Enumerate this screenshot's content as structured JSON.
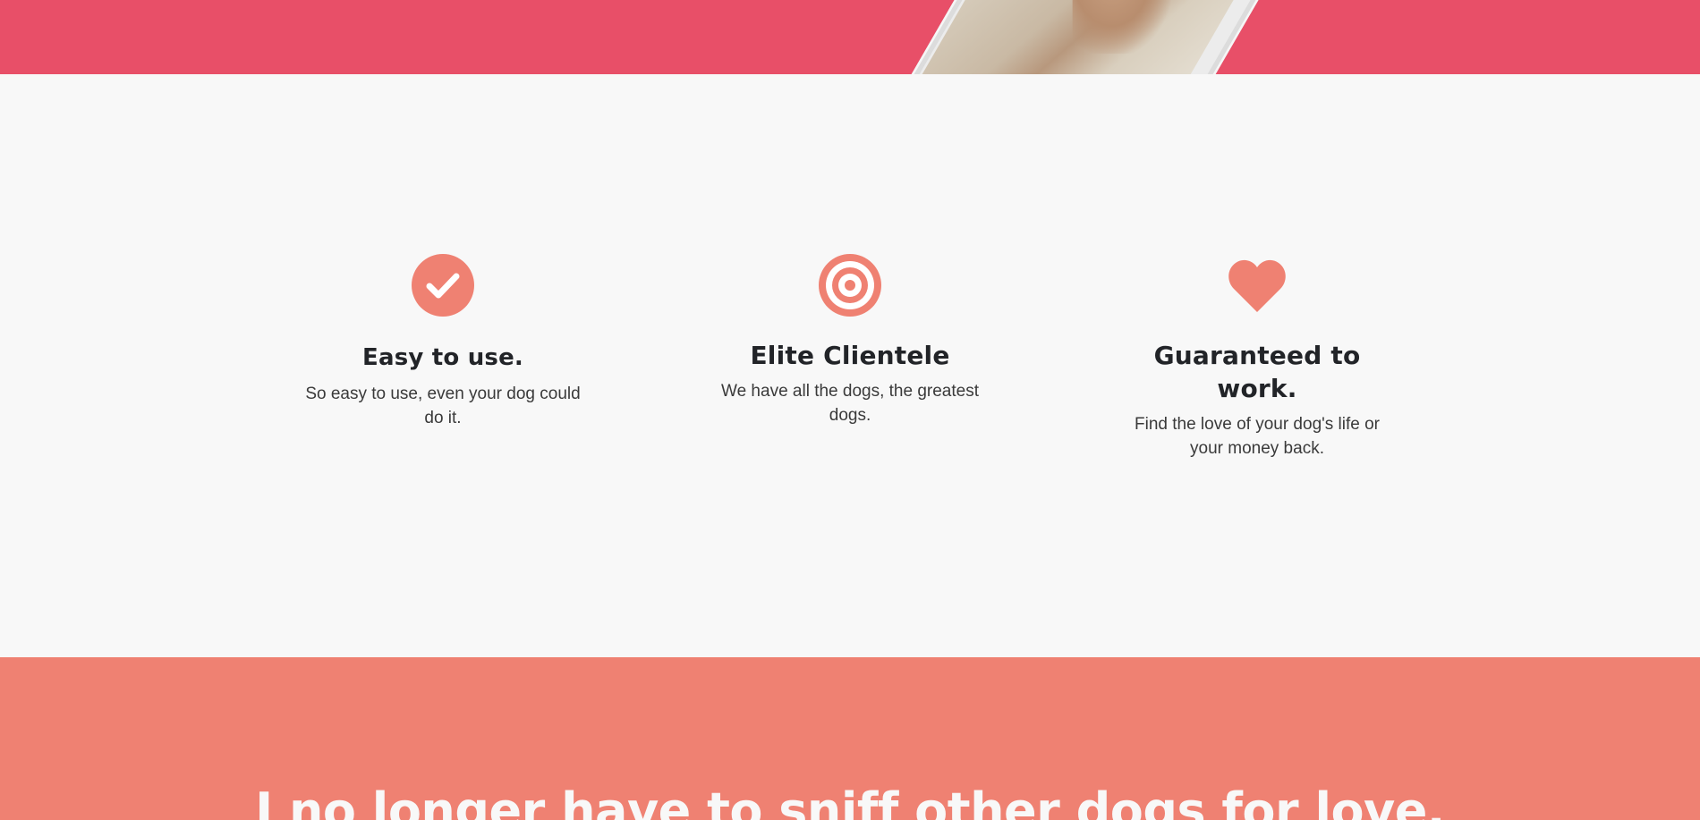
{
  "colors": {
    "hero_background": "#e84f68",
    "accent": "#ef8172",
    "section_background": "#f8f8f8",
    "heading_text": "#222428",
    "body_text": "#3a3a3a",
    "quote_text": "#f8f8f8"
  },
  "hero": {
    "image_icon": "phone-mockup-with-dog-photo"
  },
  "features": [
    {
      "icon": "check-circle-icon",
      "title": "Easy to use.",
      "text": "So easy to use, even your dog could do it."
    },
    {
      "icon": "bullseye-icon",
      "title": "Elite Clientele",
      "text": "We have all the dogs, the greatest dogs."
    },
    {
      "icon": "heart-icon",
      "title": "Guaranteed to work.",
      "text": "Find the love of your dog's life or your money back."
    }
  ],
  "testimonial": {
    "quote": "I no longer have to sniff other dogs for love."
  }
}
